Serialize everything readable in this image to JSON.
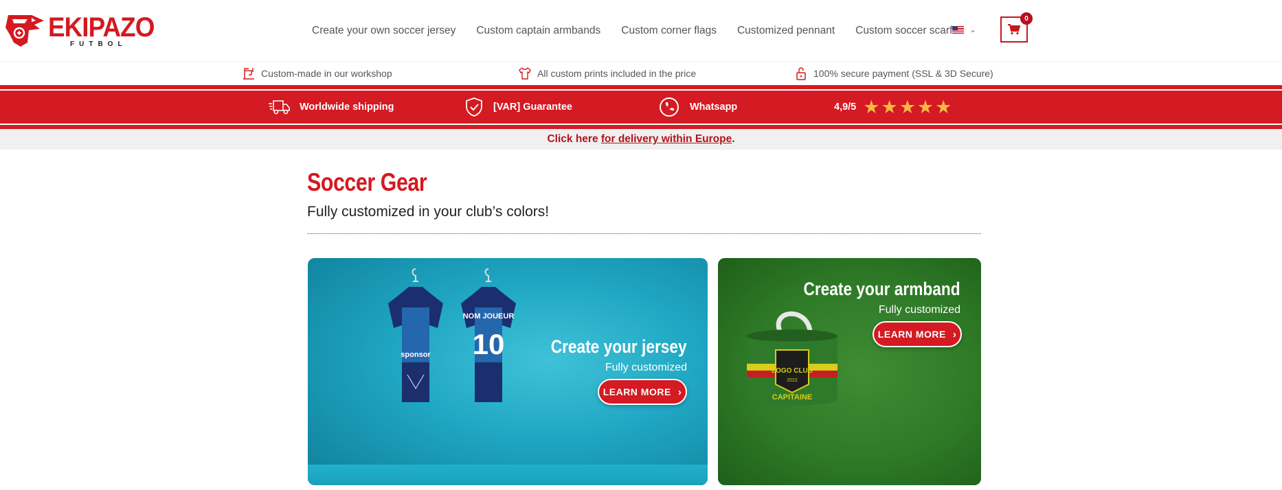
{
  "brand": {
    "name": "EKIPAZO",
    "tagline": "FUTBOL",
    "color": "#d41920"
  },
  "nav": {
    "items": [
      "Create your own soccer jersey",
      "Custom captain armbands",
      "Custom corner flags",
      "Customized pennant",
      "Custom soccer scarf"
    ],
    "language_flag": "us-flag-icon",
    "cart_count": "0"
  },
  "info_strip": [
    {
      "icon": "sewing-machine-icon",
      "text": "Custom-made in our workshop"
    },
    {
      "icon": "tshirt-icon",
      "text": "All custom prints included in the price"
    },
    {
      "icon": "lock-icon",
      "text": "100% secure payment (SSL & 3D Secure)"
    }
  ],
  "band": {
    "color": "#d41a22",
    "items": [
      {
        "icon": "truck-icon",
        "text": "Worldwide shipping"
      },
      {
        "icon": "shield-check-icon",
        "text": "[VAR] Guarantee"
      },
      {
        "icon": "whatsapp-icon",
        "text": "Whatsapp"
      }
    ],
    "rating": "4,9/5",
    "stars": 5
  },
  "notice": {
    "prefix": "Click here ",
    "link": "for delivery within Europe",
    "suffix": "."
  },
  "page": {
    "title": "Soccer Gear",
    "subtitle": "Fully customized in your club’s colors!"
  },
  "cards": {
    "jersey": {
      "title": "Create your jersey",
      "subtitle": "Fully customized",
      "button": "LEARN MORE",
      "jersey_name": "NOM JOUEUR",
      "jersey_number": "10",
      "sponsor": "sponsor"
    },
    "armband": {
      "title": "Create your armband",
      "subtitle": "Fully customized",
      "button": "LEARN MORE",
      "badge_text": "LOGO CLUB",
      "badge_year": "2022",
      "band_text": "CAPITAINE"
    }
  }
}
